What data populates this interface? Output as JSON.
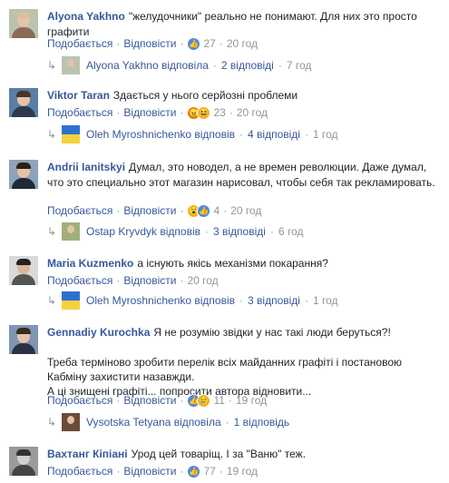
{
  "actions_common": {
    "like": "Подобається",
    "reply": "Відповісти",
    "dot": "·"
  },
  "colors": {
    "link": "#365899",
    "meta": "#90949c",
    "text": "#1d2129"
  },
  "comments": [
    {
      "author": "Alyona Yakhno",
      "text": "\"желудочники\" реально не понимают. Для них это просто графити",
      "reactions": [
        "like-icon"
      ],
      "count": "27",
      "time": "20 год",
      "reply": {
        "label": "Alyona Yakhno відповіла",
        "replies": "2 відповіді",
        "time": "7 год"
      }
    },
    {
      "author": "Viktor Taran",
      "text": "Здається у нього серйозні проблеми",
      "reactions": [
        "angry-icon",
        "haha-icon"
      ],
      "count": "23",
      "time": "20 год",
      "reply": {
        "label": "Oleh Myroshnichenko відповів",
        "replies": "4 відповіді",
        "time": "1 год"
      }
    },
    {
      "author": "Andrii Ianitskyi",
      "text": "Думал, это новодел, а не времен революции. Даже думал, что это специально этот магазин нарисовал, чтобы себя так рекламировать.",
      "reactions": [
        "wow-icon",
        "like-icon"
      ],
      "count": "4",
      "time": "20 год",
      "reply": {
        "label": "Ostap Kryvdyk відповів",
        "replies": "3 відповіді",
        "time": "6 год"
      }
    },
    {
      "author": "Maria Kuzmenko",
      "text": "а існують якісь механізми покарання?",
      "reactions": [],
      "count": "",
      "time": "",
      "reply": {
        "label": "Oleh Myroshnichenko відповів",
        "replies": "3 відповіді",
        "time": "1 год"
      }
    },
    {
      "author": "Gennadiy Kurochka",
      "text": "Я не розумію звідки у нас такі люди беруться?!",
      "para": "Треба терміново зробити перелік всіх майданних графіті і постановою Кабміну захистити назавжди.",
      "para2": "А ці знищені графіті... попросити автора відновити...",
      "reactions": [
        "like-icon",
        "sad-icon"
      ],
      "count": "11",
      "time": "19 год",
      "reply": {
        "label": "Vysotska Tetyana відповіла",
        "replies": "1 відповідь",
        "time": ""
      }
    },
    {
      "author": "Вахтанг Кіпіані",
      "text": "Урод цей товаріщ. І за \"Ваню\" теж.",
      "reactions": [
        "like-icon"
      ],
      "count": "77",
      "time": "19 год"
    }
  ]
}
